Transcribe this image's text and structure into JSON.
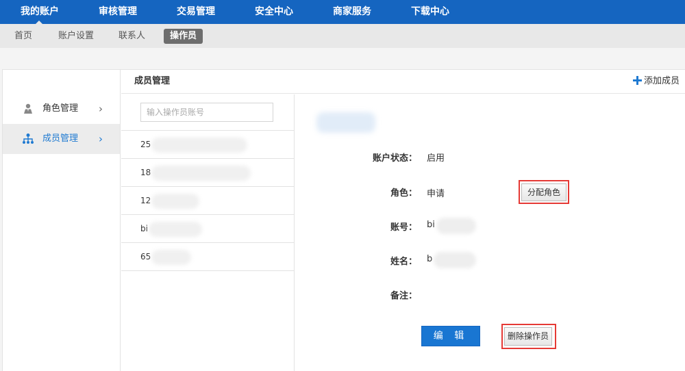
{
  "topnav": {
    "items": [
      "我的账户",
      "审核管理",
      "交易管理",
      "安全中心",
      "商家服务",
      "下载中心"
    ]
  },
  "subnav": {
    "items": [
      "首页",
      "账户设置",
      "联系人",
      "操作员"
    ],
    "active_index": 3
  },
  "sidebar": {
    "items": [
      {
        "label": "角色管理",
        "icon": "user-role-icon",
        "active": false
      },
      {
        "label": "成员管理",
        "icon": "member-tree-icon",
        "active": true
      }
    ]
  },
  "content": {
    "title": "成员管理",
    "add_label": "添加成员"
  },
  "member_list": {
    "search_placeholder": "输入操作员账号",
    "rows": [
      "25",
      "18",
      "12",
      "bi",
      "65"
    ]
  },
  "detail": {
    "status_label": "账户状态：",
    "status_value": "启用",
    "role_label": "角色：",
    "role_value": "申请",
    "assign_role_button": "分配角色",
    "account_label": "账号：",
    "account_value": "bi",
    "name_label": "姓名：",
    "name_value": "b",
    "note_label": "备注：",
    "edit_button": "编 辑",
    "delete_button": "删除操作员"
  },
  "colors": {
    "topnav_bg": "#1565c0",
    "accent": "#1f7ad1",
    "highlight_border": "#e53935",
    "primary_button": "#1976d2"
  }
}
